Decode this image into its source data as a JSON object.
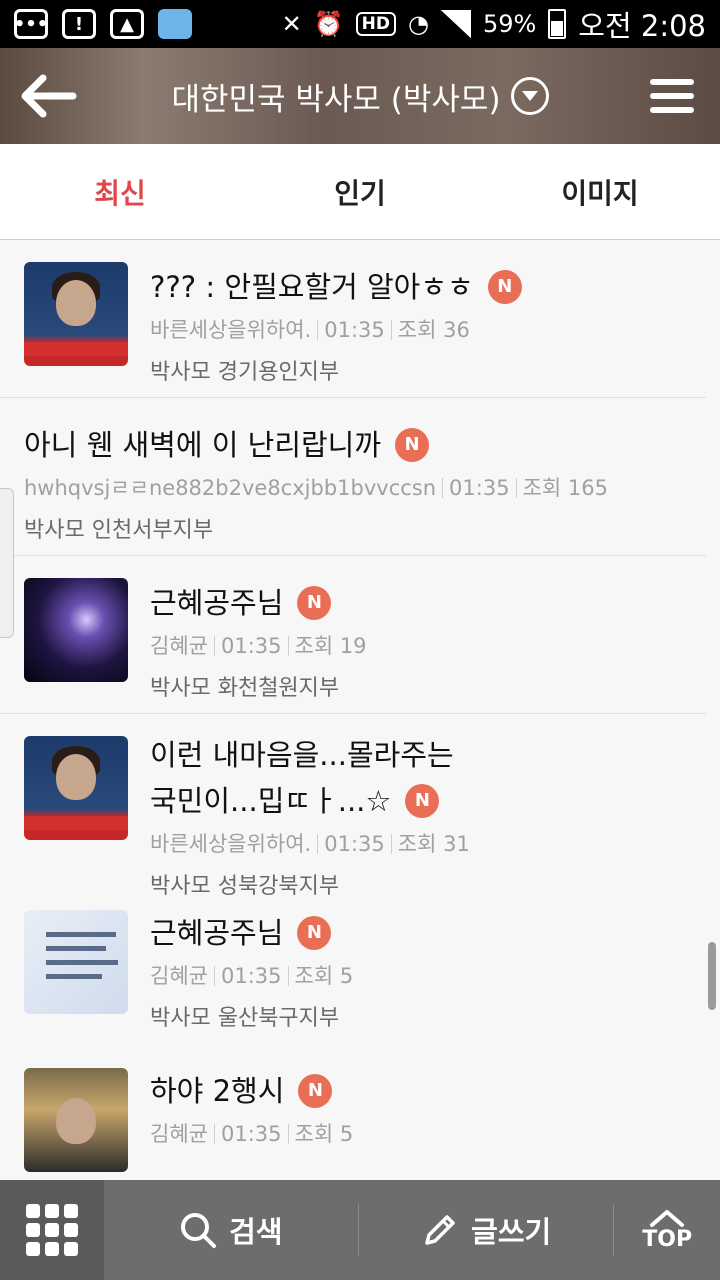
{
  "status_bar": {
    "battery": "59%",
    "time": "오전 2:08",
    "hd": "HD",
    "alert": "!"
  },
  "header": {
    "title": "대한민국 박사모 (박사모)"
  },
  "tabs": [
    {
      "label": "최신",
      "active": true
    },
    {
      "label": "인기",
      "active": false
    },
    {
      "label": "이미지",
      "active": false
    }
  ],
  "posts": [
    {
      "title": "??? : 안필요할거 알아ㅎㅎ",
      "author": "바른세상을위하여.",
      "time": "01:35",
      "views": "조회 36",
      "board": "박사모 경기용인지부",
      "badge": "N"
    },
    {
      "title": "아니 웬 새벽에 이 난리랍니까",
      "author": "hwhqvsjㄹㄹne882b2ve8cxjbb1bvvccsn",
      "time": "01:35",
      "views": "조회 165",
      "board": "박사모 인천서부지부",
      "badge": "N"
    },
    {
      "title": "근혜공주님",
      "author": "김혜균",
      "time": "01:35",
      "views": "조회 19",
      "board": "박사모 화천철원지부",
      "badge": "N"
    },
    {
      "title_line1": "이런 내마음을...몰라주는",
      "title_line2": "국민이...밉ㄸㅏ...☆",
      "author": "바른세상을위하여.",
      "time": "01:35",
      "views": "조회 31",
      "board": "박사모 성북강북지부",
      "badge": "N"
    },
    {
      "title": "근혜공주님",
      "author": "김혜균",
      "time": "01:35",
      "views": "조회 5",
      "board": "박사모 울산북구지부",
      "badge": "N"
    },
    {
      "title": "하야 2행시",
      "author": "김혜균",
      "time": "01:35",
      "views": "조회 5",
      "badge": "N"
    }
  ],
  "bottom_bar": {
    "search_label": "검색",
    "write_label": "글쓰기",
    "top_label": "TOP"
  },
  "icons": [
    "back-arrow-icon",
    "dropdown-icon",
    "menu-icon",
    "apps-grid-icon",
    "search-icon",
    "pencil-icon",
    "chevron-up-icon"
  ],
  "colors": {
    "accent": "#e0474c",
    "badge": "#e86f55",
    "bottom_bar": "#6d6d6d"
  }
}
